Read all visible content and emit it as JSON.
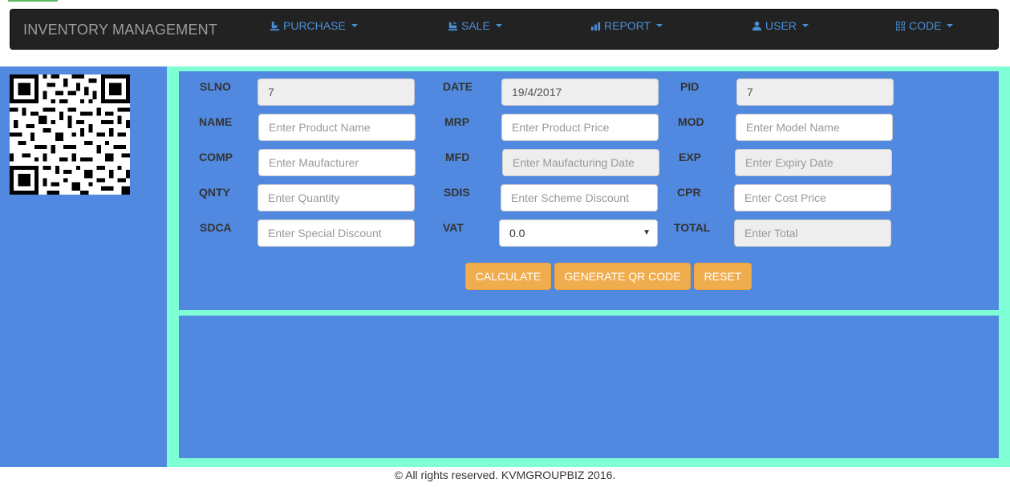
{
  "navbar": {
    "brand": "INVENTORY MANAGEMENT",
    "items": [
      {
        "label": "PURCHASE",
        "icon": "purchase-icon"
      },
      {
        "label": "SALE",
        "icon": "sale-icon"
      },
      {
        "label": "REPORT",
        "icon": "report-icon"
      },
      {
        "label": "USER",
        "icon": "user-icon"
      },
      {
        "label": "CODE",
        "icon": "qrcode-icon"
      }
    ]
  },
  "form": {
    "slno": {
      "label": "SLNO",
      "value": "7"
    },
    "date": {
      "label": "DATE",
      "value": "19/4/2017"
    },
    "pid": {
      "label": "PID",
      "value": "7"
    },
    "name": {
      "label": "NAME",
      "placeholder": "Enter Product Name"
    },
    "mrp": {
      "label": "MRP",
      "placeholder": "Enter Product Price"
    },
    "mod": {
      "label": "MOD",
      "placeholder": "Enter Model Name"
    },
    "comp": {
      "label": "COMP",
      "placeholder": "Enter Maufacturer"
    },
    "mfd": {
      "label": "MFD",
      "placeholder": "Enter Maufacturing Date"
    },
    "exp": {
      "label": "EXP",
      "placeholder": "Enter Expiry Date"
    },
    "qnty": {
      "label": "QNTY",
      "placeholder": "Enter Quantity"
    },
    "sdis": {
      "label": "SDIS",
      "placeholder": "Enter Scheme Discount"
    },
    "cpr": {
      "label": "CPR",
      "placeholder": "Enter Cost Price"
    },
    "sdca": {
      "label": "SDCA",
      "placeholder": "Enter Special Discount"
    },
    "vat": {
      "label": "VAT",
      "value": "0.0"
    },
    "total": {
      "label": "TOTAL",
      "placeholder": "Enter Total"
    }
  },
  "buttons": {
    "calculate": "CALCULATE",
    "generate": "GENERATE QR CODE",
    "reset": "RESET"
  },
  "footer": "© All rights reserved. KVMGROUPBIZ 2016.",
  "colors": {
    "accent": "#f0ad4e",
    "panel": "#5089df",
    "frame": "#7fffd4",
    "navbar": "#222222"
  }
}
